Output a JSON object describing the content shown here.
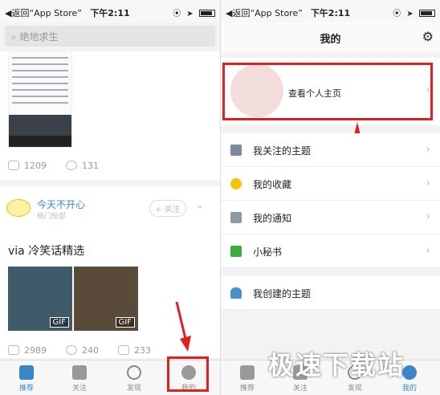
{
  "left": {
    "status": {
      "back": "◀返回“App Store”",
      "time": "下午2:11"
    },
    "search_placeholder": "绝地求生",
    "feed_top": {
      "likes": "1209",
      "comments": "131"
    },
    "post": {
      "topic": "今天不开心",
      "subtopic": "桃门份部",
      "follow": "+ 关注",
      "title": "via 冷笑话精选",
      "gif1": "GIF",
      "gif2": "GIF",
      "likes": "2989",
      "comments": "240",
      "shares": "233"
    },
    "tabs": [
      {
        "label": "推荐"
      },
      {
        "label": "关注"
      },
      {
        "label": "发现"
      },
      {
        "label": "我的"
      }
    ]
  },
  "right": {
    "status": {
      "back": "◀返回“App Store”",
      "time": "下午2:11"
    },
    "nav_title": "我的",
    "profile_label": "查看个人主页",
    "menu": [
      {
        "label": "我关注的主题",
        "color": "#7a8a9a"
      },
      {
        "label": "我的收藏",
        "color": "#f6c400"
      },
      {
        "label": "我的通知",
        "color": "#8c9aa8"
      },
      {
        "label": "小秘书",
        "color": "#3daa3d"
      }
    ],
    "my_created": "我创建的主题",
    "tabs": [
      {
        "label": "推荐"
      },
      {
        "label": "关注"
      },
      {
        "label": "发现"
      },
      {
        "label": "我的"
      }
    ],
    "watermark": "极速下载站"
  },
  "colors": {
    "accent": "#3a86c8",
    "highlight": "#e02020"
  }
}
